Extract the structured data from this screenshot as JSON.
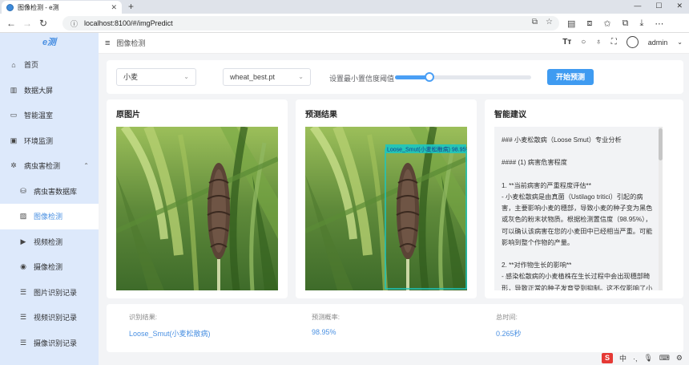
{
  "browser": {
    "tab_title": "图像检测 - e测",
    "new_tab": "+",
    "url": "localhost:8100/#/imgPredict"
  },
  "sidebar": {
    "brand": "e测",
    "items": [
      {
        "label": "首页",
        "icon": "home-icon"
      },
      {
        "label": "数据大屏",
        "icon": "chart-icon"
      },
      {
        "label": "智能温室",
        "icon": "chat-icon"
      },
      {
        "label": "环境监测",
        "icon": "monitor-icon"
      },
      {
        "label": "病虫害检测",
        "icon": "bug-icon"
      },
      {
        "label": "病虫害数据库",
        "icon": "database-icon"
      },
      {
        "label": "图像检测",
        "icon": "image-icon"
      },
      {
        "label": "视频检测",
        "icon": "video-icon"
      },
      {
        "label": "摄像检测",
        "icon": "camera-icon"
      },
      {
        "label": "图片识别记录",
        "icon": "record-icon"
      },
      {
        "label": "视频识别记录",
        "icon": "record-icon"
      },
      {
        "label": "摄像识别记录",
        "icon": "record-icon"
      }
    ]
  },
  "header": {
    "breadcrumb": "图像检测",
    "user": "admin"
  },
  "controls": {
    "crop_select": "小麦",
    "model_select": "wheat_best.pt",
    "threshold_label": "设置最小置信度阈值",
    "threshold_value": 0.25,
    "start_button": "开始预测"
  },
  "panels": {
    "original_title": "原图片",
    "result_title": "预测结果",
    "advice_title": "智能建议",
    "detection_label": "Loose_Smut(小麦松散病) 98.95%"
  },
  "advice_lines": [
    "### 小麦松散病（Loose Smut）专业分析",
    "",
    "#### (1) 病害危害程度",
    "",
    "1. **当前病害的严重程度评估**",
    "   - 小麦松散病是由真菌（Ustilago tritici）引起的病",
    "害，主要影响小麦的穗部，导致小麦的种子变为黑色",
    "或灰色的粉末状物质。根据检测置信度（98.95%），",
    "可以确认该病害在您的小麦田中已经相当严重。可能",
    "影响到整个作物的产量。",
    "",
    "2. **对作物生长的影响**",
    "   - 感染松散病的小麦植株在生长过程中会出现穗部畸",
    "形，导致正常的种子发育受到抑制。这不仅影响了小"
  ],
  "results": {
    "result_label": "识别结果:",
    "result_value": "Loose_Smut(小麦松散病)",
    "prob_label": "预测概率:",
    "prob_value": "98.95%",
    "time_label": "总时间:",
    "time_value": "0.265秒"
  },
  "colors": {
    "accent": "#4a90e2",
    "sidebar_bg": "#dde9fb",
    "button": "#3f9bf1",
    "detect_box": "#1cc6c0"
  }
}
